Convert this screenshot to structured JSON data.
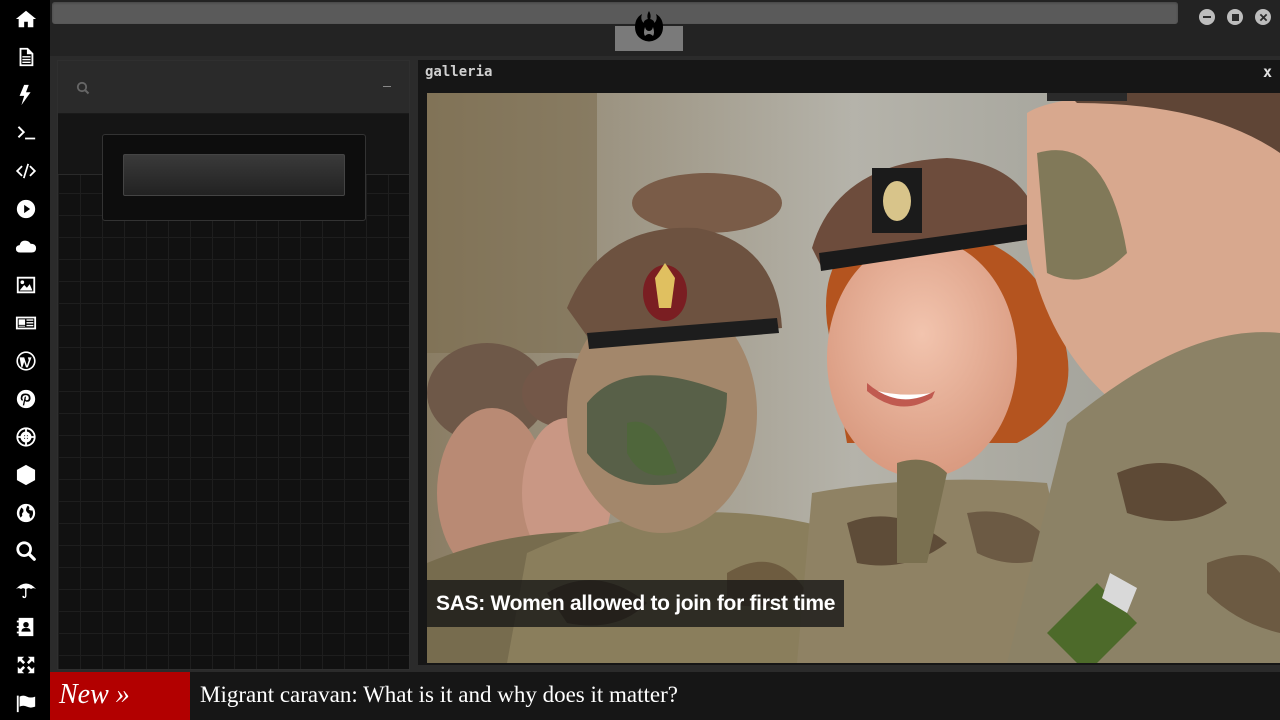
{
  "sidebar": {
    "items": [
      {
        "icon": "home-icon"
      },
      {
        "icon": "document-icon"
      },
      {
        "icon": "lightning-icon"
      },
      {
        "icon": "terminal-icon"
      },
      {
        "icon": "code-icon"
      },
      {
        "icon": "play-icon"
      },
      {
        "icon": "cloud-icon"
      },
      {
        "icon": "image-icon"
      },
      {
        "icon": "newspaper-icon"
      },
      {
        "icon": "wordpress-icon"
      },
      {
        "icon": "pinterest-icon"
      },
      {
        "icon": "galactic-empire-icon"
      },
      {
        "icon": "polyhedron-icon"
      },
      {
        "icon": "globe-icon"
      },
      {
        "icon": "search-icon"
      },
      {
        "icon": "umbrella-icon"
      },
      {
        "icon": "contact-book-icon"
      },
      {
        "icon": "expand-icon"
      },
      {
        "icon": "flag-icon"
      }
    ]
  },
  "header": {
    "logo_icon": "rebel-alliance-icon"
  },
  "search_panel": {
    "input_value": "",
    "minimize_label": "–"
  },
  "gallery": {
    "title": "galleria",
    "close_label": "x",
    "caption": "SAS: Women allowed to join for first time"
  },
  "ticker": {
    "label": "New »",
    "headline": "Migrant caravan: What is it and why does it matter?"
  },
  "colors": {
    "ticker_label_bg": "#b20000",
    "sidebar_bg": "#000000",
    "panel_bg": "#111111"
  }
}
